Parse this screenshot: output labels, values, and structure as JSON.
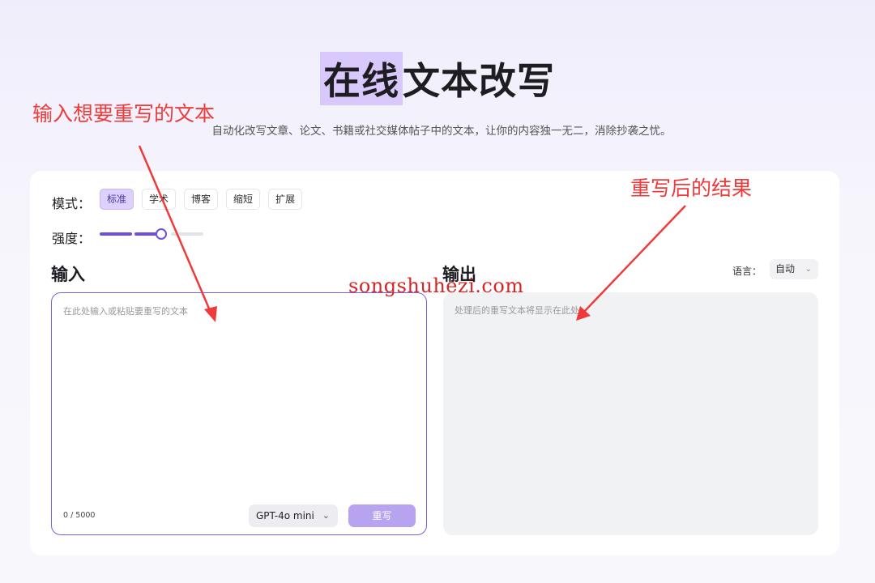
{
  "header": {
    "title_highlight": "在线",
    "title_rest": "文本改写",
    "subtitle": "自动化改写文章、论文、书籍或社交媒体帖子中的文本，让你的内容独一无二，消除抄袭之忧。"
  },
  "controls": {
    "mode_label": "模式：",
    "modes": [
      "标准",
      "学术",
      "博客",
      "缩短",
      "扩展"
    ],
    "active_mode": "标准",
    "strength_label": "强度：",
    "strength_level": 0.6
  },
  "input": {
    "title": "输入",
    "placeholder": "在此处输入或粘贴要重写的文本",
    "counter": "0 / 5000",
    "model": "GPT-4o mini",
    "rewrite_label": "重写"
  },
  "output": {
    "title": "输出",
    "language_label": "语言：",
    "language_value": "自动",
    "placeholder": "处理后的重写文本将显示在此处"
  },
  "annotations": {
    "input_note": "输入想要重写的文本",
    "output_note": "重写后的结果",
    "watermark": "songshuhezi.com",
    "arrow_color": "#f03a3a"
  }
}
